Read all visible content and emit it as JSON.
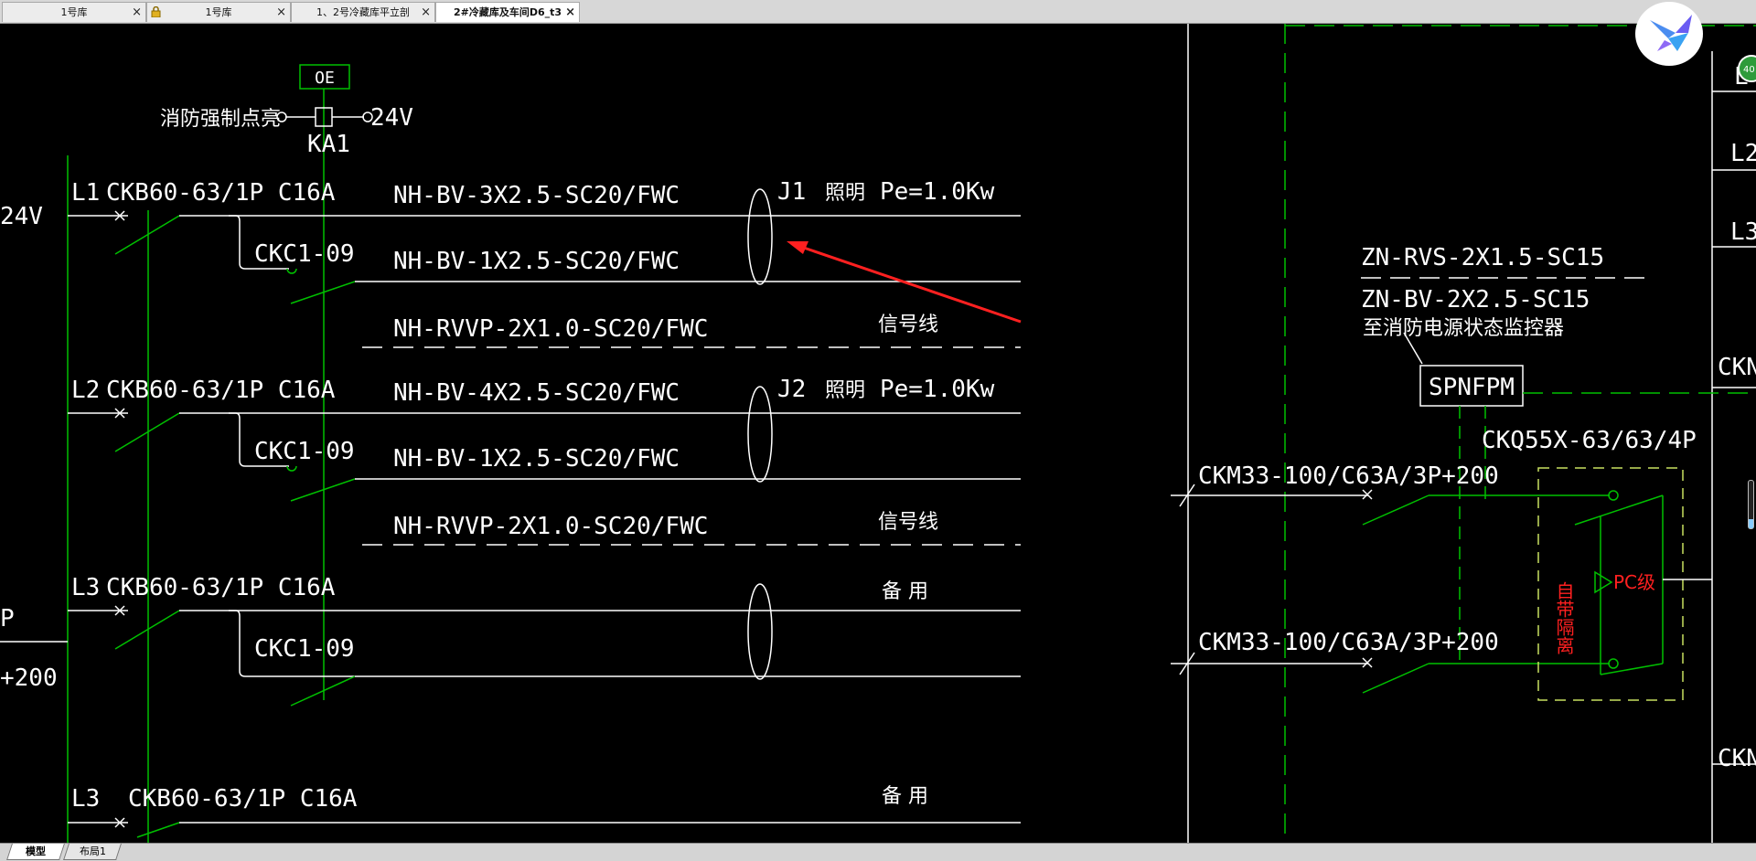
{
  "tabs": [
    {
      "label": "1号库",
      "locked": false,
      "active": false
    },
    {
      "label": "1号库",
      "locked": true,
      "active": false
    },
    {
      "label": "1、2号冷藏库平立剖",
      "locked": false,
      "active": false
    },
    {
      "label": "2#冷藏库及车间D6_t3",
      "locked": false,
      "active": true
    }
  ],
  "tab_close": "×",
  "layout_tabs": [
    "模型",
    "布局1"
  ],
  "badge": "40",
  "drawing": {
    "oe": "OE",
    "fire_force_light": "消防强制点亮",
    "ka1": "KA1",
    "v24_left": "24V",
    "v24_right": "24V",
    "edge_24v": "24V",
    "edge_p": "P",
    "edge_200": "+200",
    "circuits": [
      {
        "phase": "L1",
        "breaker": "CKB60-63/1P C16A",
        "contactor": "CKC1-09",
        "cable1": "NH-BV-3X2.5-SC20/FWC",
        "cable2": "NH-BV-1X2.5-SC20/FWC",
        "signal": "NH-RVVP-2X1.0-SC20/FWC",
        "tag": "J1",
        "load": "照明",
        "pe": "Pe=1.0Kw",
        "signal_label": "信号线"
      },
      {
        "phase": "L2",
        "breaker": "CKB60-63/1P C16A",
        "contactor": "CKC1-09",
        "cable1": "NH-BV-4X2.5-SC20/FWC",
        "cable2": "NH-BV-1X2.5-SC20/FWC",
        "signal": "NH-RVVP-2X1.0-SC20/FWC",
        "tag": "J2",
        "load": "照明",
        "pe": "Pe=1.0Kw",
        "signal_label": "信号线"
      },
      {
        "phase": "L3",
        "breaker": "CKB60-63/1P C16A",
        "contactor": "CKC1-09",
        "spare": "备 用"
      },
      {
        "phase": "L3",
        "breaker": "CKB60-63/1P C16A",
        "spare": "备 用"
      }
    ],
    "right": {
      "zn_rvs": "ZN-RVS-2X1.5-SC15",
      "zn_bv": "ZN-BV-2X2.5-SC15",
      "monitor": "至消防电源状态监控器",
      "spnfpm": "SPNFPM",
      "ckq": "CKQ55X-63/63/4P",
      "ckm1": "CKM33-100/C63A/3P+200",
      "ckm2": "CKM33-100/C63A/3P+200",
      "self_isolate": "自带隔离",
      "pc": "PC级",
      "edge_l1": "L",
      "edge_l2": "L2",
      "edge_l3": "L3",
      "edge_ck1": "CKN",
      "edge_ck2": "CKN"
    },
    "colors": {
      "wire": "#00c000",
      "text": "#ffffff",
      "arrow": "#ff2020",
      "red_text": "#ff2020",
      "dashed_box": "#c8e060"
    }
  }
}
